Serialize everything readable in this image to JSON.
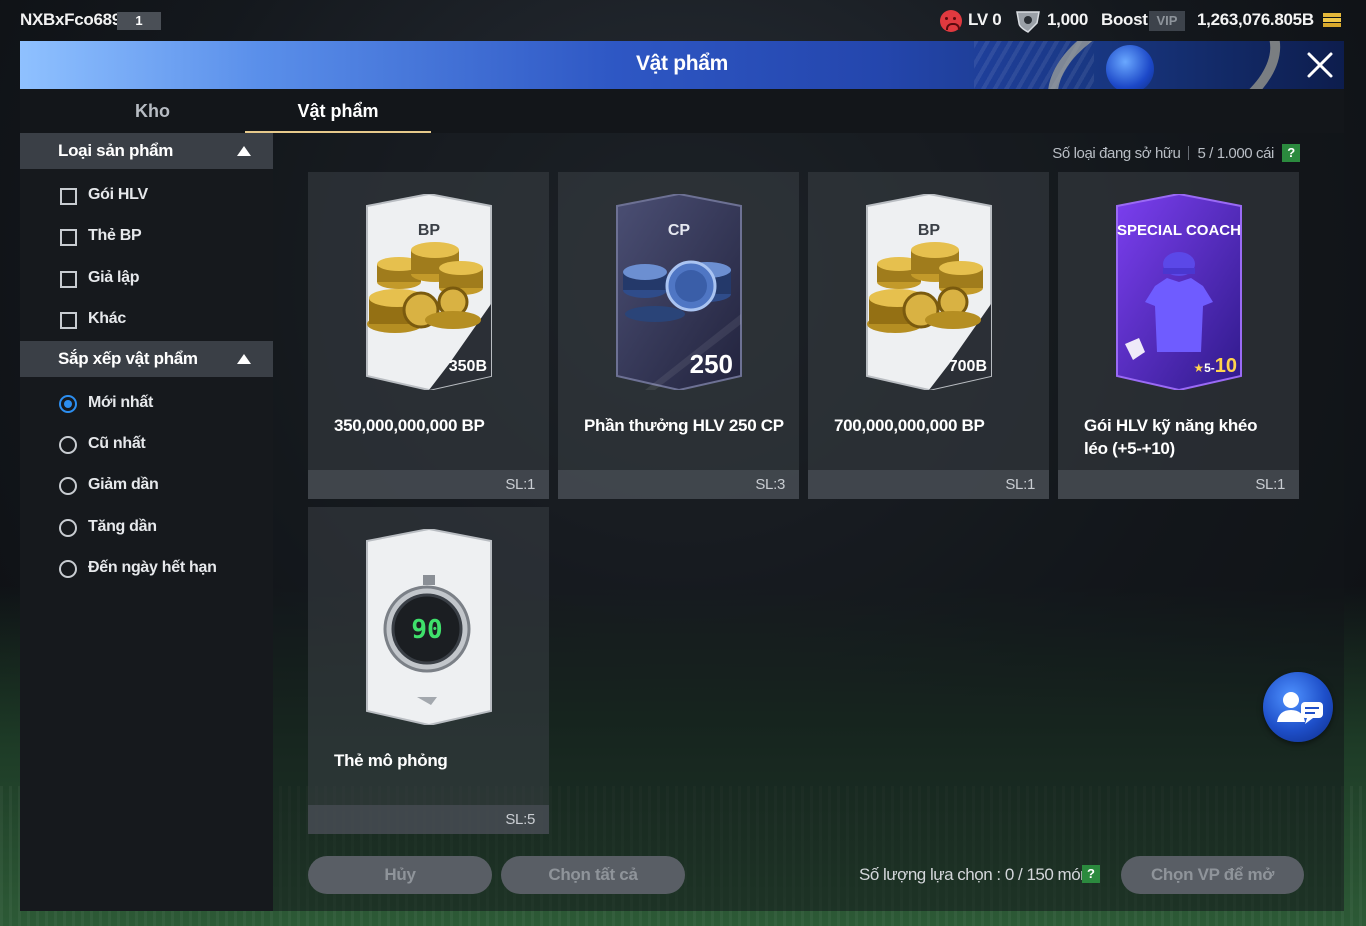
{
  "header": {
    "username": "NXBxFco689",
    "user_level": "1",
    "lv": "LV 0",
    "coins": "1,000",
    "boost": "Boost",
    "vip": "VIP",
    "bp_balance": "1,263,076.805B"
  },
  "dialog": {
    "title": "Vật phẩm",
    "tabs": [
      {
        "label": "Kho",
        "active": false
      },
      {
        "label": "Vật phẩm",
        "active": true
      }
    ]
  },
  "sidebar": {
    "product_type": {
      "title": "Loại sản phẩm",
      "options": [
        {
          "label": "Gói HLV",
          "checked": false
        },
        {
          "label": "Thẻ BP",
          "checked": false
        },
        {
          "label": "Giả lập",
          "checked": false
        },
        {
          "label": "Khác",
          "checked": false
        }
      ]
    },
    "sort": {
      "title": "Sắp xếp vật phẩm",
      "options": [
        {
          "label": "Mới nhất",
          "selected": true
        },
        {
          "label": "Cũ nhất",
          "selected": false
        },
        {
          "label": "Giảm dần",
          "selected": false
        },
        {
          "label": "Tăng dần",
          "selected": false
        },
        {
          "label": "Đến ngày hết hạn",
          "selected": false
        }
      ]
    }
  },
  "owned": {
    "label": "Số loại đang sở hữu",
    "value": "5 / 1.000 cái",
    "help": "?"
  },
  "items": [
    {
      "name": "350,000,000,000 BP",
      "qty": "SL:1",
      "tag": "BP",
      "value": "350B",
      "icon": "bp-coins-card"
    },
    {
      "name": "Phần thưởng HLV 250 CP",
      "qty": "SL:3",
      "tag": "CP",
      "value": "250",
      "icon": "cp-coins-card"
    },
    {
      "name": "700,000,000,000 BP",
      "qty": "SL:1",
      "tag": "BP",
      "value": "700B",
      "icon": "bp-coins-card"
    },
    {
      "name": "Gói HLV kỹ năng khéo léo (+5-+10)",
      "qty": "SL:1",
      "tag": "SPECIAL COACH",
      "value": "10",
      "value_prefix": "5-",
      "icon": "special-coach-card"
    },
    {
      "name": "Thẻ mô phỏng",
      "qty": "SL:5",
      "tag": "",
      "value": "90",
      "icon": "stopwatch-card"
    }
  ],
  "footer": {
    "cancel": "Hủy",
    "select_all": "Chọn tất cả",
    "selection_label": "Số lượng lựa chọn : 0 / 150 món",
    "help": "?",
    "open": "Chọn VP để mở"
  },
  "colors": {
    "accent_tab": "#e6c98b",
    "radio_on": "#2c8ef0",
    "help_badge": "#2b8a3e"
  }
}
